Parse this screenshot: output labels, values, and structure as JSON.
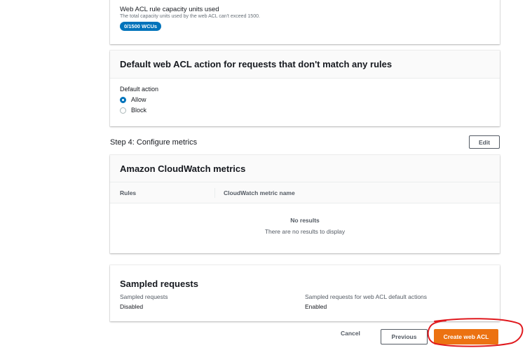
{
  "wcu": {
    "title": "Web ACL rule capacity units used",
    "description": "The total capacity units used by the web ACL can't exceed 1500.",
    "badge": "0/1500 WCUs"
  },
  "default_action": {
    "heading": "Default web ACL action for requests that don't match any rules",
    "field_label": "Default action",
    "options": [
      {
        "label": "Allow",
        "selected": true
      },
      {
        "label": "Block",
        "selected": false
      }
    ]
  },
  "step4": {
    "title": "Step 4: Configure metrics",
    "edit_label": "Edit"
  },
  "cloudwatch": {
    "heading": "Amazon CloudWatch metrics",
    "columns": [
      "Rules",
      "CloudWatch metric name"
    ],
    "empty_title": "No results",
    "empty_description": "There are no results to display"
  },
  "sampled": {
    "heading": "Sampled requests",
    "items": [
      {
        "label": "Sampled requests",
        "value": "Disabled"
      },
      {
        "label": "Sampled requests for web ACL default actions",
        "value": "Enabled"
      }
    ]
  },
  "footer": {
    "cancel_label": "Cancel",
    "previous_label": "Previous",
    "create_label": "Create web ACL"
  },
  "colors": {
    "primary_blue": "#0073bb",
    "action_orange": "#ec7211",
    "annotation_red": "#e0191e"
  }
}
